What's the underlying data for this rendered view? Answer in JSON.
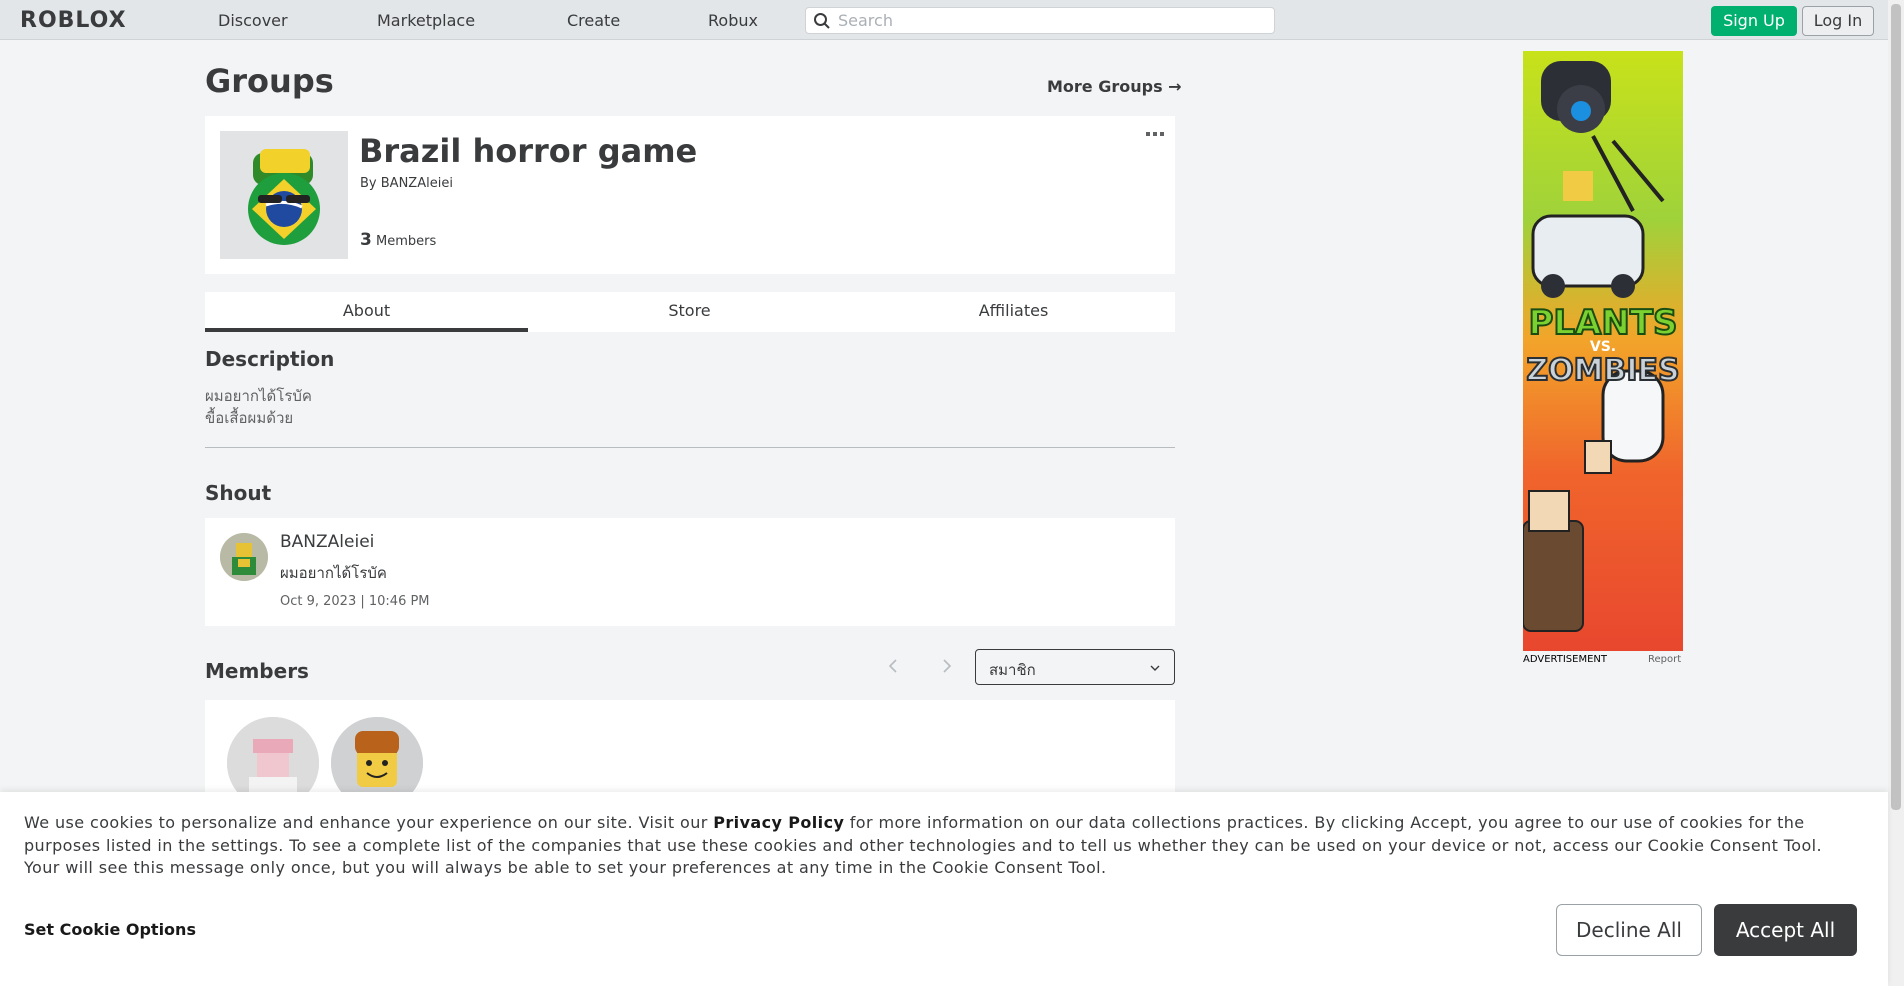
{
  "header": {
    "logo": "ROBLOX",
    "nav": [
      "Discover",
      "Marketplace",
      "Create",
      "Robux"
    ],
    "search_placeholder": "Search",
    "signup_label": "Sign Up",
    "login_label": "Log In"
  },
  "page": {
    "title": "Groups",
    "more_groups": "More Groups →"
  },
  "group": {
    "name": "Brazil horror game",
    "by_prefix": "By",
    "owner": "BANZAleiei",
    "member_count": "3",
    "members_word": "Members"
  },
  "tabs": [
    {
      "label": "About",
      "active": true
    },
    {
      "label": "Store",
      "active": false
    },
    {
      "label": "Affiliates",
      "active": false
    }
  ],
  "description": {
    "heading": "Description",
    "lines": [
      "ผมอยากได้โรบัค",
      "ขื้อเสื้อผมด้วย"
    ]
  },
  "shout": {
    "heading": "Shout",
    "user": "BANZAleiei",
    "text": "ผมอยากได้โรบัค",
    "date": "Oct 9, 2023 | 10:46 PM"
  },
  "members": {
    "heading": "Members",
    "role_selected": "สมาชิก"
  },
  "ad": {
    "label": "ADVERTISEMENT",
    "report": "Report",
    "title_line1": "PLANTS",
    "title_vs": "VS.",
    "title_line2": "ZOMBIES"
  },
  "cookie": {
    "text_before": "We use cookies to personalize and enhance your experience on our site. Visit our ",
    "privacy_link": "Privacy Policy",
    "text_after": " for more information on our data collections practices. By clicking Accept, you agree to our use of cookies for the purposes listed in the settings. To see a complete list of the companies that use these cookies and other technologies and to tell us whether they can be used on your device or not, access our Cookie Consent Tool. Your will see this message only once, but you will always be able to set your preferences at any time in the Cookie Consent Tool.",
    "options_label": "Set Cookie Options",
    "decline_label": "Decline All",
    "accept_label": "Accept All"
  },
  "colors": {
    "signup_green": "#00b06f",
    "accept_dark": "#393b3d",
    "page_bg": "#f2f4f5"
  }
}
